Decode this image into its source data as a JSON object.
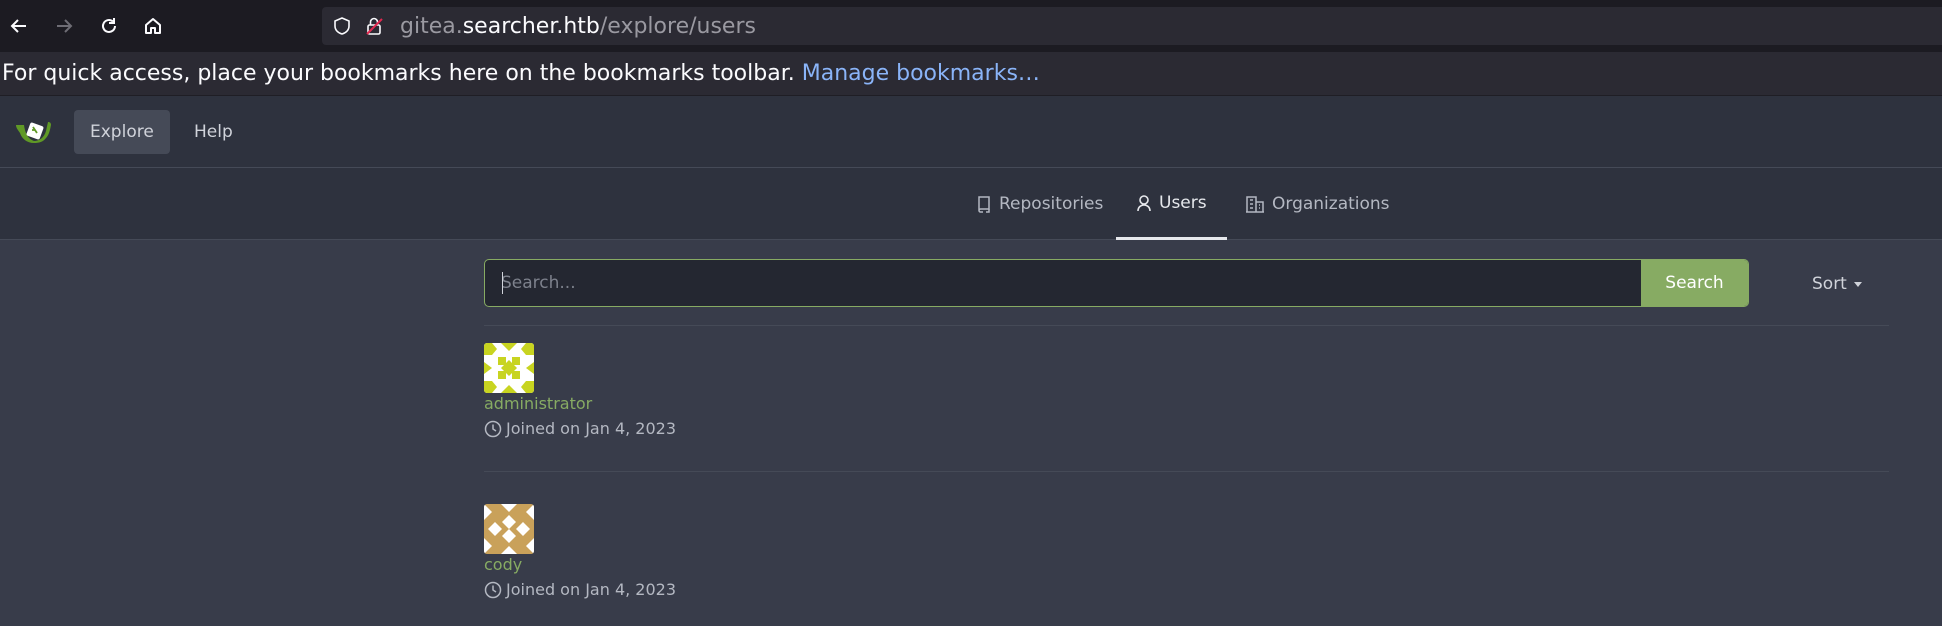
{
  "browser": {
    "url_prefix": "gitea.",
    "url_host": "searcher.htb",
    "url_path": "/explore/users",
    "bookmarks_message": "For quick access, place your bookmarks here on the bookmarks toolbar.",
    "bookmarks_link": "Manage bookmarks…"
  },
  "header": {
    "nav": [
      {
        "label": "Explore",
        "active": true
      },
      {
        "label": "Help",
        "active": false
      }
    ]
  },
  "tabs": [
    {
      "label": "Repositories",
      "icon": "repo-icon",
      "active": false
    },
    {
      "label": "Users",
      "icon": "person-icon",
      "active": true
    },
    {
      "label": "Organizations",
      "icon": "organization-icon",
      "active": false
    }
  ],
  "search": {
    "placeholder": "Search...",
    "value": "",
    "button_label": "Search",
    "sort_label": "Sort"
  },
  "users": [
    {
      "name": "administrator",
      "joined": "Joined on Jan 4, 2023",
      "avatar_color": "#c8d420"
    },
    {
      "name": "cody",
      "joined": "Joined on Jan 4, 2023",
      "avatar_color": "#c9a15a"
    }
  ],
  "colors": {
    "accent": "#87ab63",
    "background": "#383c4a",
    "header": "#2e323e"
  }
}
